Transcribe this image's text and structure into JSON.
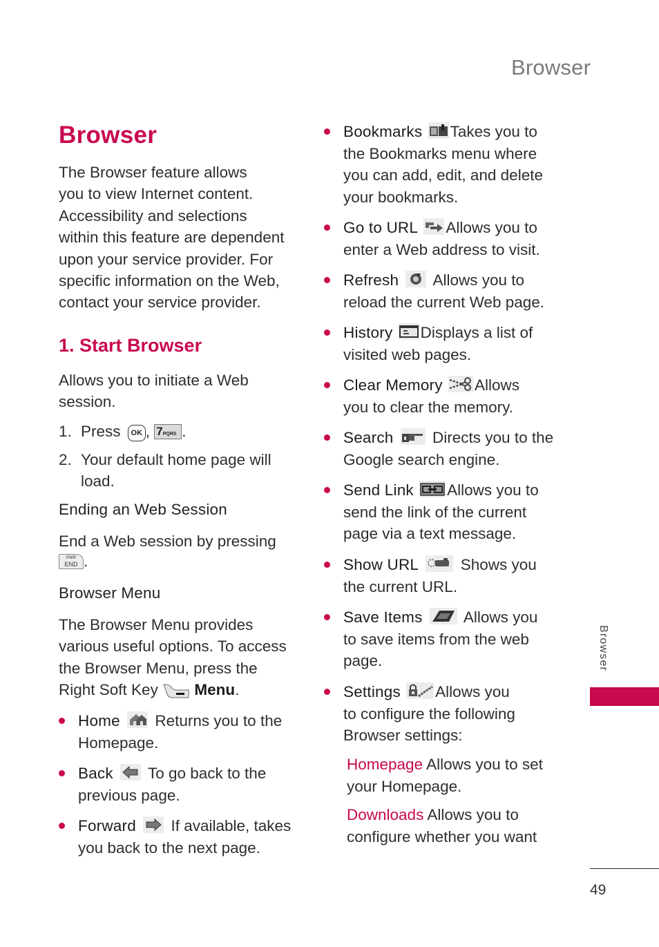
{
  "running_header": "Browser",
  "title": "Browser",
  "intro": [
    "The Browser feature allows",
    "you to view Internet content.",
    "Accessibility and selections",
    "within this feature are dependent",
    "upon your service provider. For",
    "specific information on the Web,",
    "contact your service provider."
  ],
  "section1": {
    "heading": "1. Start Browser",
    "desc": [
      "Allows you to initiate a Web",
      "session."
    ],
    "steps": [
      {
        "num": "1.",
        "prefix": "Press",
        "key_ok": "OK",
        "key_7": "7",
        "key_7_sub": "PQRS"
      },
      {
        "num": "2.",
        "lines": [
          "Your default home page will",
          "load."
        ]
      }
    ]
  },
  "ending": {
    "heading": "Ending an Web Session",
    "text": "End a Web session by pressing",
    "key_top": "PWR",
    "key_bottom": "END"
  },
  "browser_menu": {
    "heading": "Browser Menu",
    "text": [
      "The Browser Menu provides",
      "various useful options. To access",
      "the Browser Menu, press the"
    ],
    "last_line_prefix": "Right Soft Key",
    "last_line_bold": "Menu",
    "items_left": [
      {
        "label": "Home",
        "icon": "home-icon",
        "desc_first": "Returns you to the",
        "desc_rest": [
          "Homepage."
        ]
      },
      {
        "label": "Back",
        "icon": "back-arrow-icon",
        "desc_first": "To go back to the",
        "desc_rest": [
          "previous page."
        ]
      },
      {
        "label": "Forward",
        "icon": "forward-arrow-icon",
        "desc_first": "If available, takes",
        "desc_rest": [
          "you back to the next page."
        ]
      }
    ],
    "items_right": [
      {
        "label": "Bookmarks",
        "icon": "bookmarks-icon",
        "desc_first": "Takes you to",
        "desc_rest": [
          "the Bookmarks menu where",
          "you can add, edit, and delete",
          "your bookmarks."
        ]
      },
      {
        "label": "Go to URL",
        "icon": "go-to-url-icon",
        "desc_first": "Allows you to",
        "desc_rest": [
          "enter a Web address to visit."
        ]
      },
      {
        "label": "Refresh",
        "icon": "refresh-icon",
        "desc_first": "Allows you to",
        "desc_rest": [
          "reload the current Web page."
        ]
      },
      {
        "label": "History",
        "icon": "history-icon",
        "desc_first": "Displays a list of",
        "desc_rest": [
          "visited web pages."
        ]
      },
      {
        "label": "Clear Memory",
        "icon": "scissors-icon",
        "desc_first": "Allows",
        "desc_rest": [
          "you to clear the memory."
        ]
      },
      {
        "label": "Search",
        "icon": "pointing-hand-icon",
        "desc_first": "Directs you to the",
        "desc_rest": [
          "Google search engine."
        ]
      },
      {
        "label": "Send Link",
        "icon": "chain-link-icon",
        "desc_first": "Allows you to",
        "desc_rest": [
          "send the link of the current",
          "page via a text message."
        ]
      },
      {
        "label": "Show URL",
        "icon": "show-url-icon",
        "desc_first": "Shows you",
        "desc_rest": [
          "the current URL."
        ]
      },
      {
        "label": "Save Items",
        "icon": "save-items-icon",
        "desc_first": "Allows you",
        "desc_rest": [
          "to save items from the web",
          "page."
        ]
      },
      {
        "label": "Settings",
        "icon": "settings-lock-icon",
        "desc_first": "Allows you",
        "desc_rest": [
          "to configure the following",
          "Browser settings:"
        ]
      }
    ],
    "settings_sub": [
      {
        "label": "Homepage",
        "desc_first": "Allows you to set",
        "desc_rest": [
          "your Homepage."
        ]
      },
      {
        "label": "Downloads",
        "desc_first": "Allows you to",
        "desc_rest": [
          "configure whether you want"
        ]
      }
    ]
  },
  "side_tab": "Browser",
  "page_number": "49",
  "colors": {
    "accent": "#c8084f",
    "header_gray": "#7a7a7e",
    "text": "#2e2e2e"
  }
}
